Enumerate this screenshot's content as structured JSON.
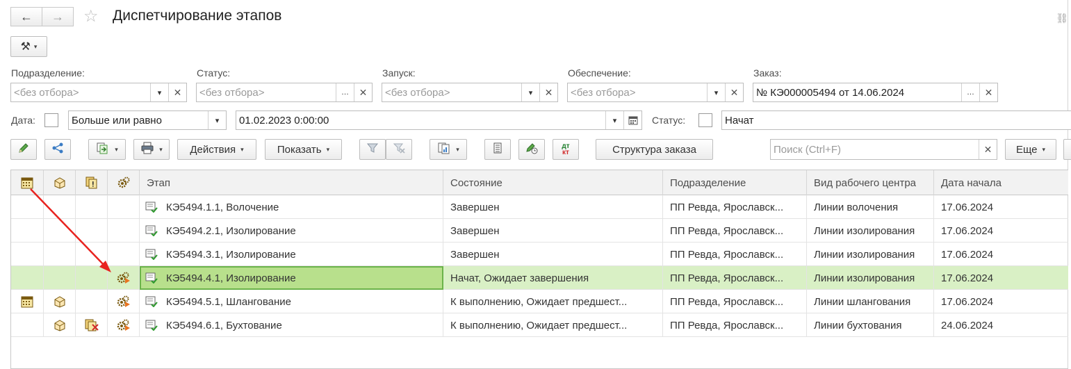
{
  "header": {
    "title": "Диспетчирование этапов",
    "back_icon": "←",
    "forward_icon": "→",
    "star_icon": "☆",
    "link_icon": "⛓"
  },
  "tools_button": {
    "icon": "⚒",
    "caret": "▾"
  },
  "filters": {
    "podrazdelenie": {
      "label": "Подразделение:",
      "placeholder": "<без отбора>"
    },
    "status": {
      "label": "Статус:",
      "placeholder": "<без отбора>"
    },
    "zapusk": {
      "label": "Запуск:",
      "placeholder": "<без отбора>"
    },
    "obespechenie": {
      "label": "Обеспечение:",
      "placeholder": "<без отбора>"
    },
    "zakaz": {
      "label": "Заказ:",
      "value": "№ КЭ000005494 от 14.06.2024"
    },
    "date_label": "Дата:",
    "date_condition": "Больше или равно",
    "date_value": "01.02.2023  0:00:00",
    "status2_label": "Статус:",
    "status2_value": "Начат"
  },
  "toolbar": {
    "actions_label": "Действия",
    "show_label": "Показать",
    "structure_label": "Структура заказа",
    "search_placeholder": "Поиск (Ctrl+F)",
    "more_label": "Еще",
    "dtkt_top": "дт",
    "dtkt_bottom": "кт"
  },
  "table": {
    "columns": [
      "Этап",
      "Состояние",
      "Подразделение",
      "Вид рабочего центра",
      "Дата начала"
    ],
    "rows": [
      {
        "etap": "КЭ5494.1.1, Волочение",
        "state": "Завершен",
        "dept": "ПП Ревда, Ярославск...",
        "center": "Линии волочения",
        "date": "17.06.2024"
      },
      {
        "etap": "КЭ5494.2.1, Изолирование",
        "state": "Завершен",
        "dept": "ПП Ревда, Ярославск...",
        "center": "Линии изолирования",
        "date": "17.06.2024"
      },
      {
        "etap": "КЭ5494.3.1, Изолирование",
        "state": "Завершен",
        "dept": "ПП Ревда, Ярославск...",
        "center": "Линии изолирования",
        "date": "17.06.2024"
      },
      {
        "etap": "КЭ5494.4.1, Изолирование",
        "state": "Начат, Ожидает завершения",
        "dept": "ПП Ревда, Ярославск...",
        "center": "Линии изолирования",
        "date": "17.06.2024"
      },
      {
        "etap": "КЭ5494.5.1, Шлангование",
        "state": "К выполнению, Ожидает предшест...",
        "dept": "ПП Ревда, Ярославск...",
        "center": "Линии шлангования",
        "date": "17.06.2024"
      },
      {
        "etap": "КЭ5494.6.1, Бухтование",
        "state": "К выполнению, Ожидает предшест...",
        "dept": "ПП Ревда, Ярославск...",
        "center": "Линии бухтования",
        "date": "24.06.2024"
      }
    ]
  },
  "colors": {
    "selected_row": "#d9f0c5",
    "selected_cell": "#b8e08c",
    "annotation_arrow": "#e8231f"
  }
}
